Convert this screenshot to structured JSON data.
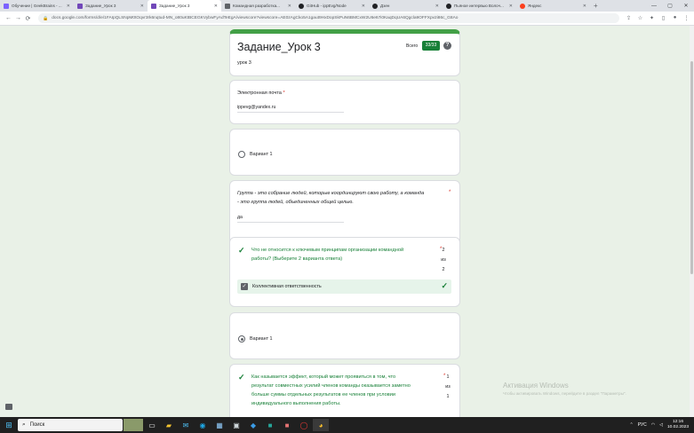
{
  "browser": {
    "tabs": [
      {
        "title": "Обучение | GeekBrains - ...",
        "favicon_color": "#7b61ff",
        "active": false
      },
      {
        "title": "Задание_Урок 3",
        "favicon_color": "#7248b9",
        "active": false
      },
      {
        "title": "Задание_Урок 3",
        "favicon_color": "#7248b9",
        "active": true
      },
      {
        "title": "Командная разработка...",
        "favicon_color": "#5f6368",
        "active": false
      },
      {
        "title": "GitHub - ippEvg/Node",
        "favicon_color": "#202124",
        "active": false
      },
      {
        "title": "Дзен",
        "favicon_color": "#202124",
        "active": false
      },
      {
        "title": "Пьяное интервью Волоч...",
        "favicon_color": "#202124",
        "active": false
      },
      {
        "title": "Яндекс",
        "favicon_color": "#fc3f1d",
        "active": false
      }
    ],
    "new_tab_label": "+",
    "window_controls": {
      "minimize": "—",
      "maximize": "▢",
      "close": "✕"
    },
    "nav": {
      "back": "←",
      "forward": "→",
      "reload": "⟳"
    },
    "url": "docs.google.com/forms/d/e/1FAIpQLSNpM0tOqvr3rk6nqtud-MN_o80uKtBCEGKVybwFyAdTeEgA/viewscore?viewscore=AE0zAgCko5A1gaut9HxDopSkPuN6BMCxW2U6e67i0KaqDqUA6Qgcla9OFFXpv2i86c_G8Ao",
    "toolbar_icons": [
      "share-icon",
      "star-icon",
      "extensions-icon",
      "sidebar-icon",
      "profile-icon",
      "menu-icon"
    ]
  },
  "form": {
    "title": "Задание_Урок 3",
    "description": "урок 3",
    "total_label": "Всего",
    "score": "33/33",
    "help": "?",
    "email": {
      "label": "Электронная почта",
      "required_mark": "*",
      "value": "ippevg@yandex.ru"
    },
    "q_variant1": {
      "option": "Вариант 1"
    },
    "q_group": {
      "text_line1": "Группа - это собрание людей, которые координируют свою работу, а команда",
      "text_line2": "- это группа людей, объединенных общей целью.",
      "required_mark": "*",
      "answer": "да"
    },
    "q_principles": {
      "text_line1": "Что не относится к ключевым принципам организации командной",
      "text_line2": "работы? (Выберите 2 варианта ответа)",
      "required_mark": "*",
      "points_line1": "2",
      "points_line2": "из",
      "points_line3": "2",
      "correct_option": "Коллективная ответственность",
      "checkbox_mark": "✓",
      "check_mark": "✓"
    },
    "q_variant1_checked": {
      "option": "Вариант 1"
    },
    "q_effect": {
      "text_line1": "Как называется эффект, который может проявиться в том, что",
      "text_line2": "результат совместных усилий членов команды оказывается заметно",
      "text_line3": "больше суммы отдельных результатов ее членов при условии",
      "text_line4": "индивидуального выполнения работы.",
      "required_mark": "*",
      "points_line1": "1",
      "points_line2": "из",
      "points_line3": "1",
      "check_mark": "✓"
    }
  },
  "watermark": {
    "title": "Активация Windows",
    "subtitle": "Чтобы активировать Windows, перейдите в раздел \"Параметры\"."
  },
  "taskbar": {
    "search_placeholder": "Поиск",
    "search_icon": "⌕",
    "start_icon": "⊞",
    "apps": [
      "widgets-icon",
      "task-view-icon",
      "file-explorer-icon",
      "mail-icon",
      "edge-icon",
      "store-icon",
      "terminal-icon",
      "vscode-icon",
      "app-icon",
      "app-icon",
      "opera-icon",
      "chrome-icon"
    ],
    "tray_lang": "РУС",
    "time": "12:16",
    "date": "10.02.2023"
  },
  "colors": {
    "accent": "#43a047",
    "correct": "#188038",
    "required": "#d93025",
    "background": "#e9f1e7"
  }
}
